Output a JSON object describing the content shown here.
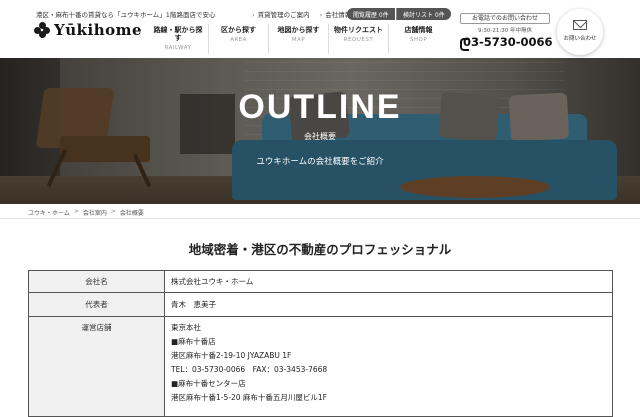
{
  "header": {
    "tagline": "港区・麻布十番の賃貸なら「ユウキホーム」1階路面店で安心",
    "logo_text": "Yūkihome",
    "top_links": [
      "賃貸管理のご案内",
      "会社情報"
    ],
    "history_pill": "閲覧履歴 0件",
    "search_list_pill": "検討リスト 0件",
    "nav": [
      {
        "label": "路線・駅から探す",
        "en": "RAILWAY"
      },
      {
        "label": "区から探す",
        "en": "AREA"
      },
      {
        "label": "地図から探す",
        "en": "MAP"
      },
      {
        "label": "物件リクエスト",
        "en": "REQUEST"
      },
      {
        "label": "店舗情報",
        "en": "SHOP"
      }
    ],
    "phone_inquiry": "お電話でのお問い合わせ",
    "hours": "9:30-21:30 年中無休",
    "phone_number": "03-5730-0066",
    "contact_label": "お問い合わせ"
  },
  "hero": {
    "title": "OUTLINE",
    "subtitle": "会社概要",
    "description": "ユウキホームの会社概要をご紹介"
  },
  "breadcrumb": [
    "ユウキ・ホーム",
    "会社案内",
    "会社概要"
  ],
  "main": {
    "heading": "地域密着・港区の不動産のプロフェッショナル",
    "table": [
      {
        "key": "会社名",
        "value": "株式会社ユウキ・ホーム"
      },
      {
        "key": "代表者",
        "value": "青木　恵美子"
      },
      {
        "key": "運営店舗",
        "lines": [
          "東京本社",
          "■麻布十番店",
          "港区麻布十番2-19-10 JYAZABU 1F",
          "TEL：03-5730-0066　FAX：03-3453-7668",
          "■麻布十番センター店",
          "港区麻布十番1-5-20 麻布十番五月川屋ビル1F"
        ]
      }
    ]
  },
  "colors": {
    "pill_bg": "#555555",
    "table_key_bg": "#f0f0f0",
    "sofa": "#2f6a86"
  }
}
